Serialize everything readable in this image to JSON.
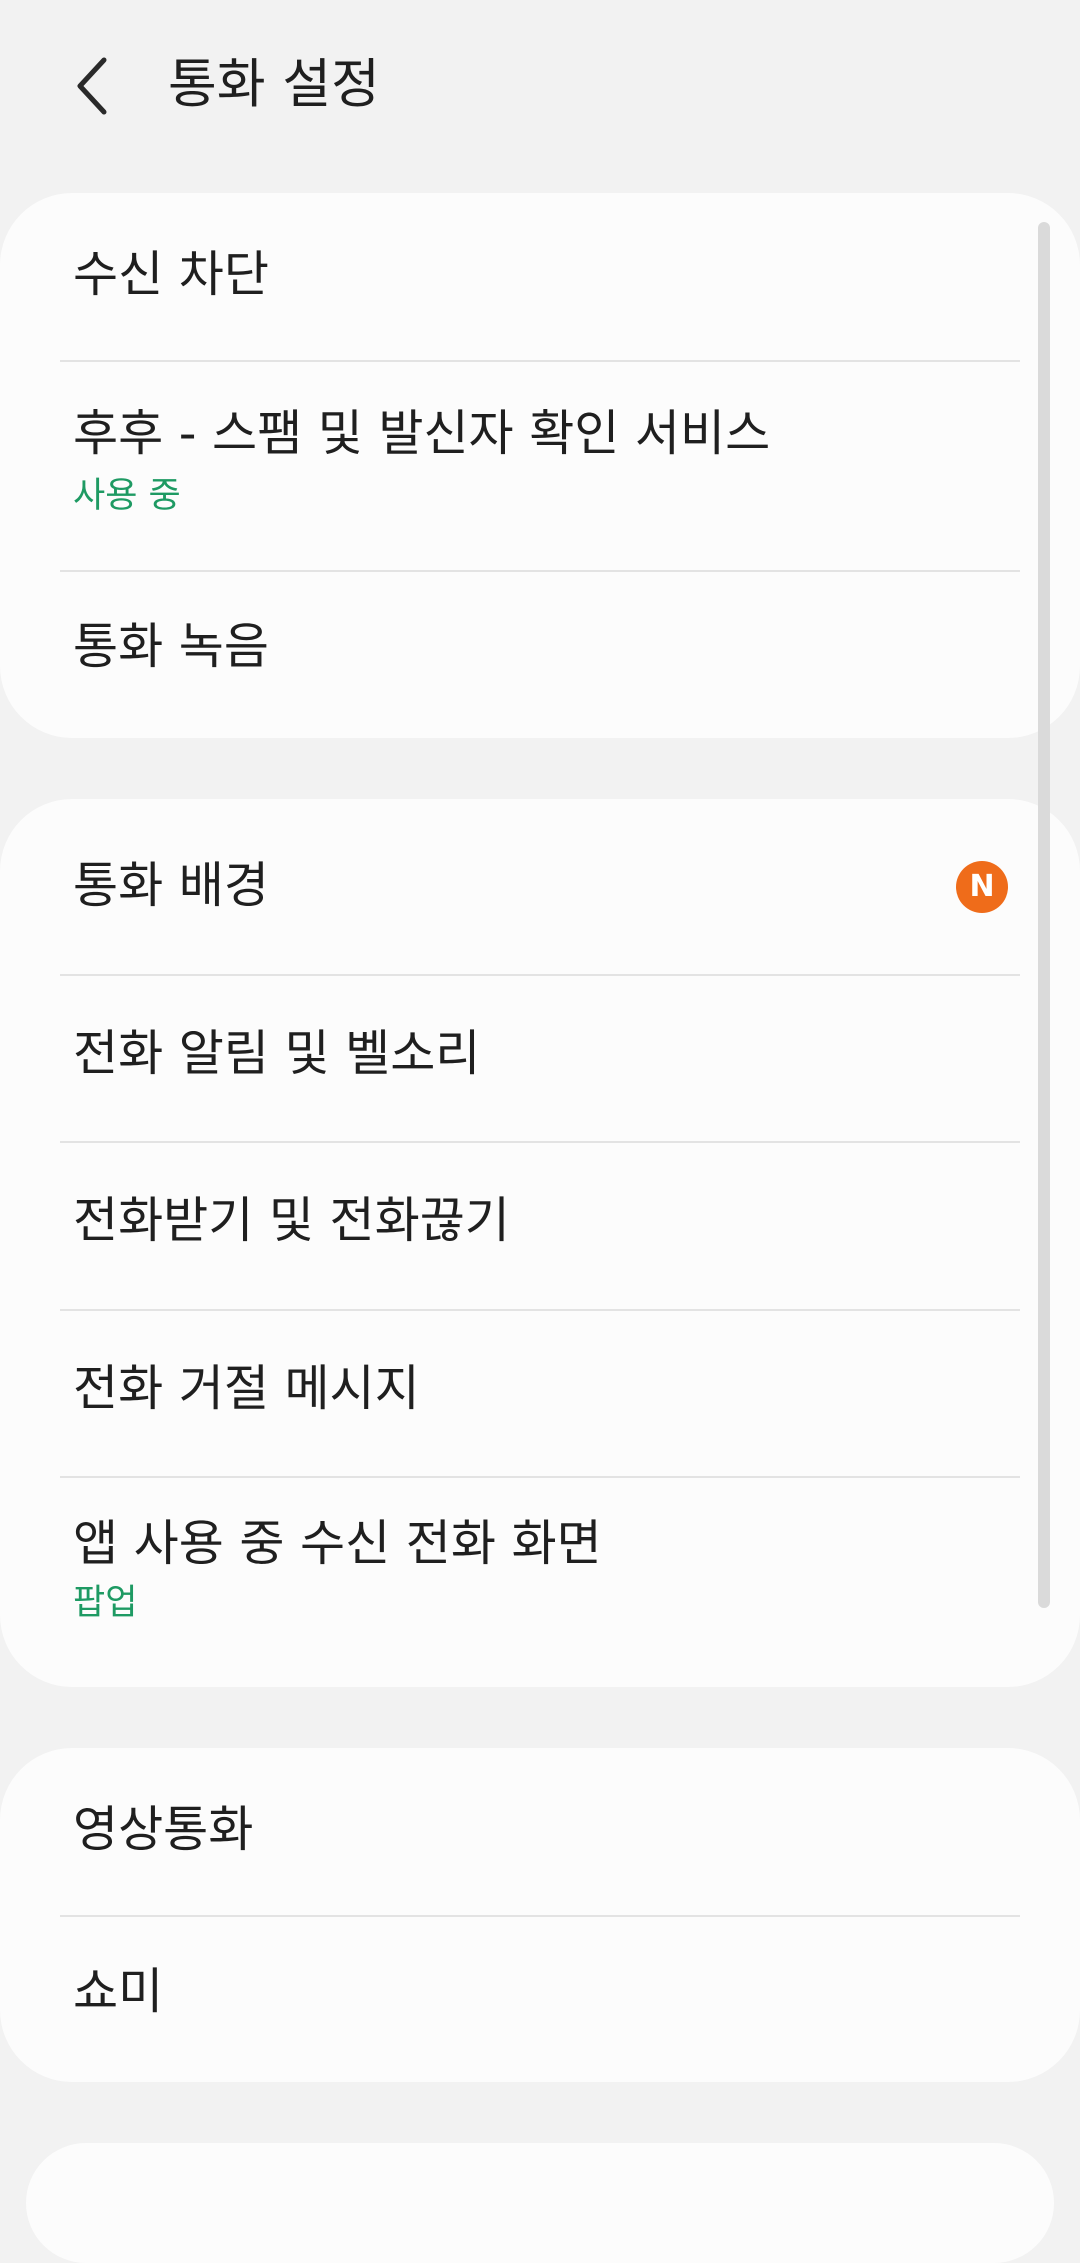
{
  "header": {
    "title": "통화 설정",
    "back_icon": "chevron-left-icon"
  },
  "groups": [
    {
      "items": [
        {
          "label": "수신 차단"
        },
        {
          "label": "후후 - 스팸 및 발신자 확인 서비스",
          "sub": "사용 중"
        },
        {
          "label": "통화 녹음"
        }
      ]
    },
    {
      "items": [
        {
          "label": "통화 배경",
          "badge": "N"
        },
        {
          "label": "전화 알림 및 벨소리"
        },
        {
          "label": "전화받기 및 전화끊기"
        },
        {
          "label": "전화 거절 메시지"
        },
        {
          "label": "앱 사용 중 수신 전화 화면",
          "sub": "팝업"
        }
      ]
    },
    {
      "items": [
        {
          "label": "영상통화"
        },
        {
          "label": "쇼미"
        }
      ]
    }
  ],
  "colors": {
    "background": "#f2f2f2",
    "card": "#fcfcfc",
    "status_green": "#1e9a63",
    "badge_orange": "#ef6c1a"
  }
}
